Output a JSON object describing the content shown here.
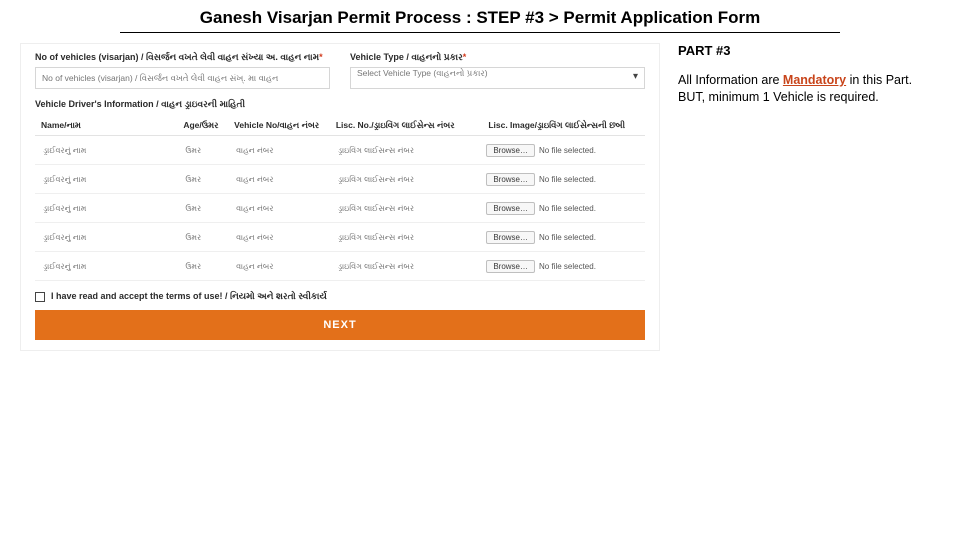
{
  "title": "Ganesh Visarjan Permit Process : STEP #3 > Permit Application Form",
  "side": {
    "heading": "PART #3",
    "line1a": "All Information are ",
    "mand": "Mandatory",
    "line1b": " in this Part. BUT, minimum 1 Vehicle is required."
  },
  "fields": {
    "vcount_label": "No of vehicles (visarjan) / વિસર્જન વખતે લેવી વાહન સંખ્યા અ. વાહન નામ",
    "vcount_ast": "*",
    "vcount_ph": "No of vehicles (visarjan) / વિસર્જન વખતે લેવી વાહન સંખ્. મા વાહન",
    "vtype_label": "Vehicle Type / વાહનનો પ્રકાર",
    "vtype_ast": "*",
    "vtype_sel": "Select Vehicle Type (વાહનનો પ્રકાર)"
  },
  "driver_section": "Vehicle Driver's Information / વાહન ડ્રાઇવરની માહિતી",
  "cols": {
    "name": "Name/નામ",
    "age": "Age/ઉમર",
    "vno": "Vehicle No/વાહન નંબર",
    "lic": "Lisc. No./ડ્રાઇવિંગ લાઈસેન્સ નંબર",
    "img": "Lisc. Image/ડ્રાઇવિંગ લાઈસેન્સની છબી"
  },
  "rows": [
    {
      "name_ph": "ડ્રાઈવરનું નામ",
      "age_ph": "ઉમર",
      "vno_ph": "વાહન નંબર",
      "lic_ph": "ડ્રાઇવિંગ લાઈસન્સ નંબર",
      "browse": "Browse…",
      "nofile": "No file selected."
    },
    {
      "name_ph": "ડ્રાઈવરનું નામ",
      "age_ph": "ઉમર",
      "vno_ph": "વાહન નંબર",
      "lic_ph": "ડ્રાઇવિંગ લાઈસન્સ નંબર",
      "browse": "Browse…",
      "nofile": "No file selected."
    },
    {
      "name_ph": "ડ્રાઈવરનું નામ",
      "age_ph": "ઉમર",
      "vno_ph": "વાહન નંબર",
      "lic_ph": "ડ્રાઇવિંગ લાઈસન્સ નંબર",
      "browse": "Browse…",
      "nofile": "No file selected."
    },
    {
      "name_ph": "ડ્રાઈવરનું નામ",
      "age_ph": "ઉમર",
      "vno_ph": "વાહન નંબર",
      "lic_ph": "ડ્રાઇવિંગ લાઈસન્સ નંબર",
      "browse": "Browse…",
      "nofile": "No file selected."
    },
    {
      "name_ph": "ડ્રાઈવરનું નામ",
      "age_ph": "ઉમર",
      "vno_ph": "વાહન નંબર",
      "lic_ph": "ડ્રાઇવિંગ લાઈસન્સ નંબર",
      "browse": "Browse…",
      "nofile": "No file selected."
    }
  ],
  "terms": "I have read and accept the terms of use! / નિયમો અને શરતો સ્વીકાર્ય",
  "next": "NEXT"
}
